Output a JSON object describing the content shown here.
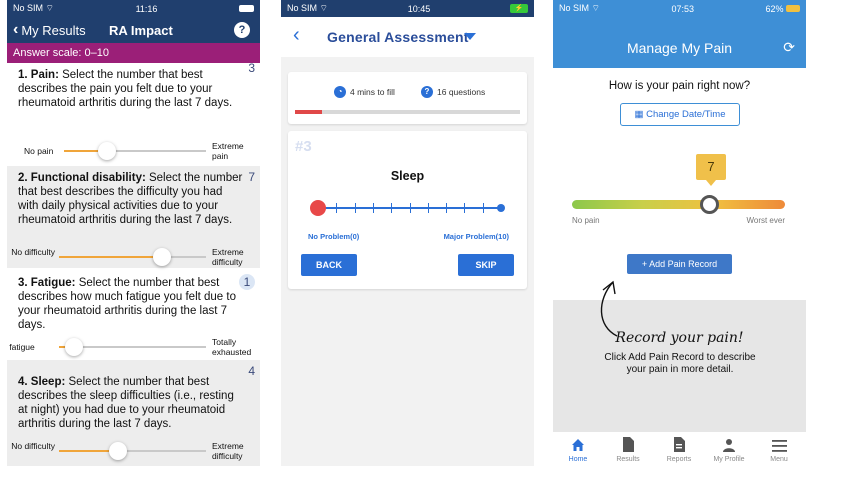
{
  "screen1": {
    "status": {
      "carrier": "No SIM",
      "time": "11:16"
    },
    "nav": {
      "back_label": "My Results",
      "title": "RA Impact",
      "help_label": "?"
    },
    "answer_scale": "Answer scale: 0–10",
    "questions": [
      {
        "title": "1. Pain:",
        "text": " Select the number that best describes the pain you felt due to your rheumatoid arthritis during the last 7 days.",
        "value": "3",
        "min_label": "No pain",
        "max_label": "Extreme pain",
        "level": 0.3
      },
      {
        "title": "2. Functional disability:",
        "text": " Select the number that best describes the difficulty you had with daily physical activities due to your rheumatoid arthritis during the last 7 days.",
        "value": "7",
        "min_label": "No difficulty",
        "max_label": "Extreme difficulty",
        "level": 0.7
      },
      {
        "title": "3. Fatigue:",
        "text": " Select the number that best describes how much fatigue you felt due to your rheumatoid arthritis during the last 7 days.",
        "value": "1",
        "min_label": "No fatigue",
        "max_label": "Totally exhausted",
        "level": 0.1
      },
      {
        "title": "4. Sleep:",
        "text": " Select the number that best describes the sleep difficulties (i.e., resting at night) you had due to your rheumatoid arthritis during the last 7 days.",
        "value": "4",
        "min_label": "No difficulty",
        "max_label": "Extreme difficulty",
        "level": 0.4
      }
    ]
  },
  "screen2": {
    "status": {
      "carrier": "No SIM",
      "time": "10:45"
    },
    "nav": {
      "title": "General Assessment"
    },
    "info": {
      "time": "4 mins to fill",
      "count": "16 questions"
    },
    "progress": 0.12,
    "question": {
      "number": "#3",
      "title": "Sleep",
      "min_label": "No Problem(0)",
      "max_label": "Major Problem(10)",
      "level": 0
    },
    "buttons": {
      "back": "BACK",
      "skip": "SKIP"
    },
    "colors": {
      "accent": "#2a6fd6",
      "knob": "#e84848"
    }
  },
  "screen3": {
    "status": {
      "carrier": "No SIM",
      "time": "07:53",
      "battery": "62%"
    },
    "header": {
      "title": "Manage My Pain"
    },
    "question": "How is your pain right now?",
    "date_button": "Change Date/Time",
    "pain_value": "7",
    "pain_level": 0.7,
    "slider": {
      "min_label": "No pain",
      "max_label": "Worst ever"
    },
    "add_button": "+ Add Pain Record",
    "callout": {
      "title": "Record your pain!",
      "text": "Click Add Pain Record to describe your pain in more detail."
    },
    "tabs": [
      {
        "label": "Home",
        "icon": "home-icon",
        "active": true
      },
      {
        "label": "Results",
        "icon": "document-icon",
        "active": false
      },
      {
        "label": "Reports",
        "icon": "report-icon",
        "active": false
      },
      {
        "label": "My Profile",
        "icon": "user-icon",
        "active": false
      },
      {
        "label": "Menu",
        "icon": "menu-icon",
        "active": false
      }
    ],
    "colors": {
      "header": "#3e8fd6"
    }
  }
}
